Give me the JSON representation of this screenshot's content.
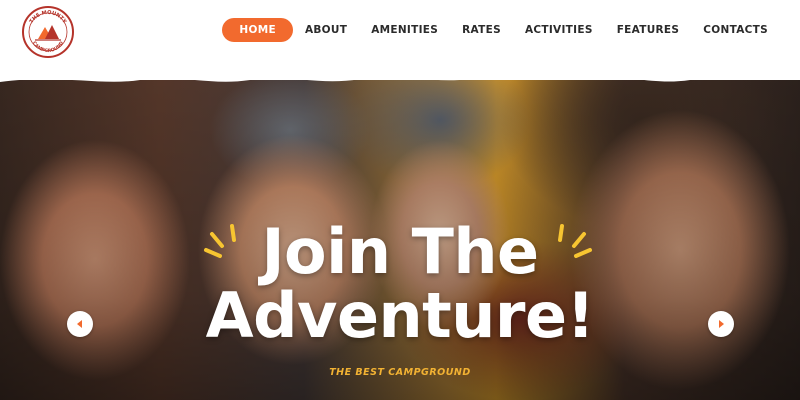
{
  "brand": {
    "line1": "THE MOUNTY",
    "line2": "CAMPGROUND",
    "color": "#b5332a",
    "accent": "#f26a2e"
  },
  "nav": {
    "items": [
      {
        "label": "HOME",
        "active": true
      },
      {
        "label": "ABOUT",
        "active": false
      },
      {
        "label": "AMENITIES",
        "active": false
      },
      {
        "label": "RATES",
        "active": false
      },
      {
        "label": "ACTIVITIES",
        "active": false
      },
      {
        "label": "FEATURES",
        "active": false
      },
      {
        "label": "CONTACTS",
        "active": false
      }
    ]
  },
  "hero": {
    "title_line1": "Join The",
    "title_line2": "Adventure!",
    "subtitle": "THE BEST CAMPGROUND",
    "subtitle_color": "#f2b233",
    "spark_color": "#f7c531"
  },
  "slider": {
    "prev_icon": "caret-left-icon",
    "next_icon": "caret-right-icon"
  }
}
